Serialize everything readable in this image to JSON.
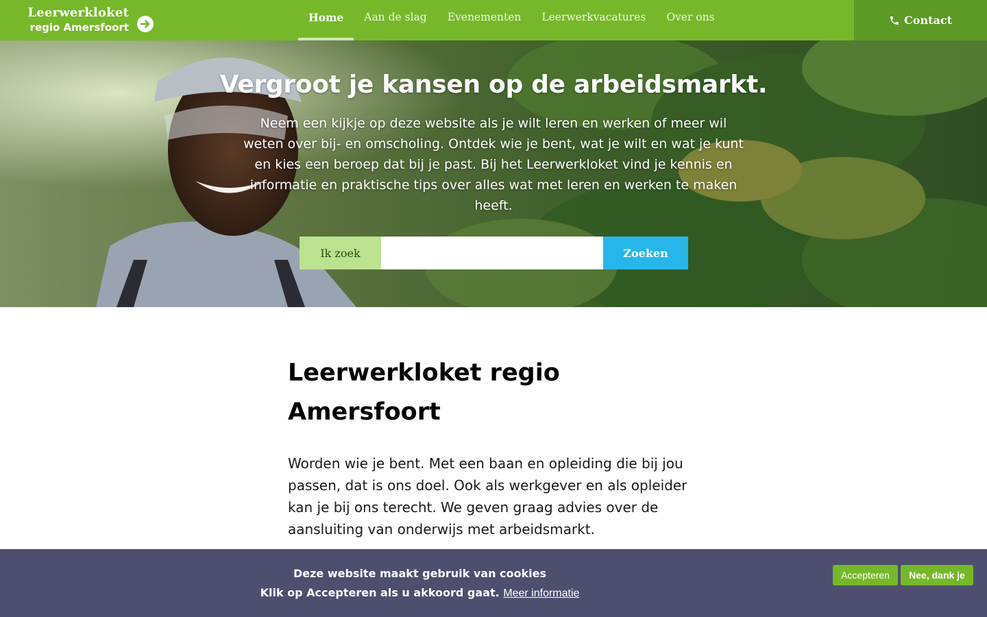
{
  "header": {
    "logo": {
      "line1": "Leerwerkloket",
      "line2": "regio Amersfoort",
      "arrow_icon": "arrow-right-circle-icon"
    },
    "nav": [
      {
        "label": "Home",
        "active": true
      },
      {
        "label": "Aan de slag",
        "active": false
      },
      {
        "label": "Evenementen",
        "active": false
      },
      {
        "label": "Leerwerkvacatures",
        "active": false
      },
      {
        "label": "Over ons",
        "active": false
      }
    ],
    "contact": {
      "label": "Contact",
      "icon": "phone-icon"
    }
  },
  "hero": {
    "title": "Vergroot je kansen op de arbeidsmarkt.",
    "text": "Neem een kijkje op deze website als je wilt leren en werken of meer wil weten over bij- en omscholing. Ontdek wie je bent, wat je wilt en wat je kunt en kies een beroep dat bij je past. Bij het Leerwerkloket vind je kennis en informatie en praktische tips over alles wat met leren en werken te maken heeft.",
    "search": {
      "label": "Ik zoek",
      "value": "",
      "placeholder": "",
      "button": "Zoeken"
    }
  },
  "main": {
    "title": "Leerwerkloket regio Amersfoort",
    "text": "Worden wie je bent. Met een baan en opleiding die bij jou passen, dat is ons doel. Ook als werkgever en als opleider kan je bij ons terecht. We geven graag advies over de aansluiting van onderwijs met arbeidsmarkt."
  },
  "cookie": {
    "line1": "Deze website maakt gebruik van cookies",
    "line2": "Klik op Accepteren als u akkoord gaat.",
    "more_info": "Meer informatie",
    "accept": "Accepteren",
    "decline": "Nee, dank je"
  },
  "colors": {
    "brand_green": "#76b82a",
    "contact_green": "#5d9a26",
    "search_label_bg": "#bbe28f",
    "search_button": "#27b6ea",
    "cookie_bar": "#4e4f6e"
  }
}
